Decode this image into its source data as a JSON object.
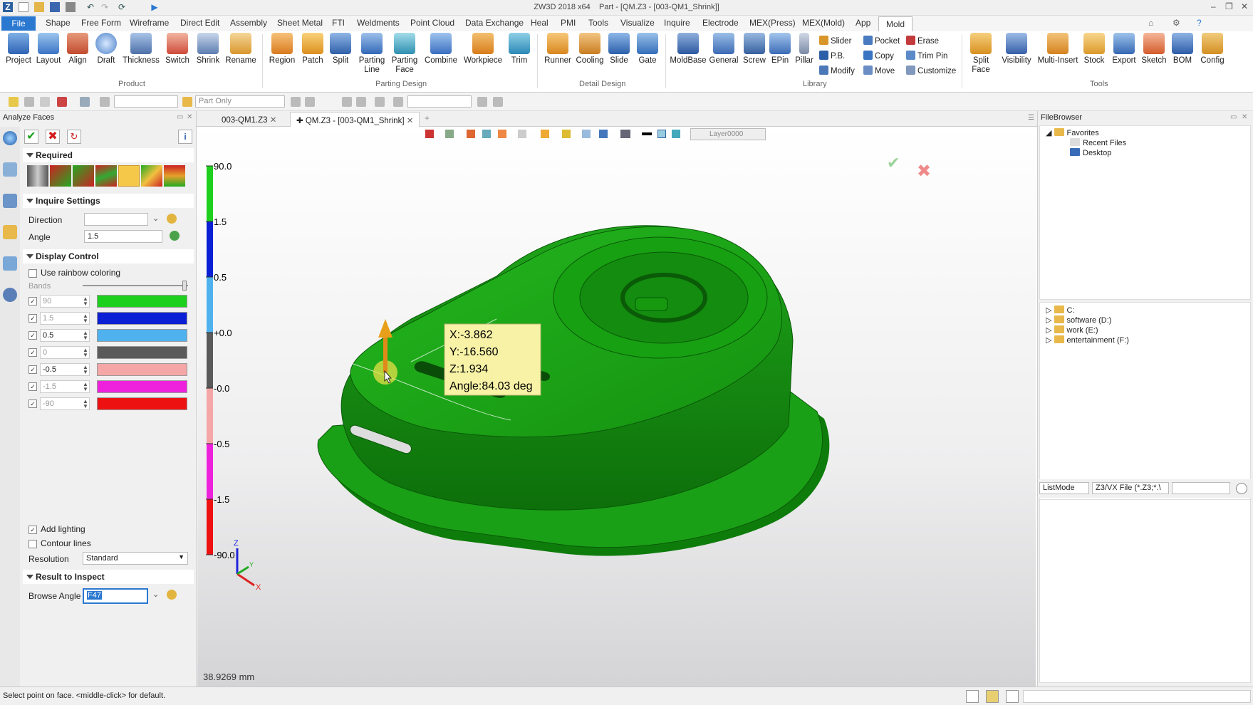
{
  "app": {
    "title": "ZW3D 2018 x64",
    "doc_title": "Part - [QM.Z3 - [003-QM1_Shrink]]"
  },
  "menu": [
    "Shape",
    "Free Form",
    "Wireframe",
    "Direct Edit",
    "Assembly",
    "Sheet Metal",
    "FTI",
    "Weldments",
    "Point Cloud",
    "Data Exchange",
    "Heal",
    "PMI",
    "Tools",
    "Visualize",
    "Inquire",
    "Electrode",
    "MEX(Press)",
    "MEX(Mold)",
    "App"
  ],
  "menu_file": "File",
  "menu_active": "Mold",
  "ribbon": {
    "product": [
      "Project",
      "Layout",
      "Align",
      "Draft",
      "Thickness",
      "Switch",
      "Shrink",
      "Rename"
    ],
    "parting": [
      "Region",
      "Patch",
      "Split",
      "Parting Line",
      "Parting Face",
      "Combine",
      "Workpiece",
      "Trim"
    ],
    "detail": [
      "Runner",
      "Cooling",
      "Slide",
      "Gate"
    ],
    "library": [
      "MoldBase",
      "General",
      "Screw",
      "EPin",
      "Pillar"
    ],
    "library_small": [
      "Slider",
      "Pocket",
      "Erase",
      "P.B.",
      "Copy",
      "Trim Pin",
      "Modify",
      "Move",
      "Customize"
    ],
    "tools": [
      "Split Face",
      "Visibility",
      "Multi-Insert",
      "Stock",
      "Export",
      "Sketch",
      "BOM",
      "Config"
    ],
    "groups": {
      "product": "Product",
      "parting": "Parting Design",
      "detail": "Detail Design",
      "library": "Library",
      "tools": "Tools"
    }
  },
  "toolbar2": {
    "filter": "Part Only"
  },
  "left": {
    "title": "Analyze Faces",
    "required": "Required",
    "inquire": "Inquire Settings",
    "direction_label": "Direction",
    "direction_value": "",
    "angle_label": "Angle",
    "angle_value": "1.5",
    "display": "Display Control",
    "rainbow": "Use rainbow coloring",
    "bands_label": "Bands",
    "bands": [
      {
        "value": "90",
        "color": "#1ed01e"
      },
      {
        "value": "1.5",
        "color": "#0b1fd4"
      },
      {
        "value": "0.5",
        "color": "#4fb2ee"
      },
      {
        "value": "0",
        "color": "#5a5a5a"
      },
      {
        "value": "-0.5",
        "color": "#f5a6a6"
      },
      {
        "value": "-1.5",
        "color": "#ee22dd"
      },
      {
        "value": "-90",
        "color": "#ee1111"
      }
    ],
    "lighting": "Add lighting",
    "contour": "Contour lines",
    "resolution_label": "Resolution",
    "resolution_value": "Standard",
    "result": "Result to Inspect",
    "browse_label": "Browse Angle",
    "browse_value": "F47"
  },
  "tabs": [
    "003-QM1.Z3",
    "QM.Z3 - [003-QM1_Shrink]"
  ],
  "viewport": {
    "layer": "Layer0000",
    "scale_labels": [
      "90.0",
      "1.5",
      "0.5",
      "+0.0",
      "-0.0",
      "-0.5",
      "-1.5",
      "-90.0"
    ],
    "tooltip": {
      "x": "X:-3.862",
      "y": "Y:-16.560",
      "z": "Z:1.934",
      "angle": "Angle:84.03 deg"
    },
    "dimension": "38.9269 mm",
    "axis": {
      "x": "X",
      "y": "Y",
      "z": "Z"
    }
  },
  "filebrowser": {
    "title": "FileBrowser",
    "favorites": "Favorites",
    "recent": "Recent Files",
    "desktop": "Desktop",
    "drives": [
      "C:",
      "software (D:)",
      "work (E:)",
      "entertainment (F:)"
    ],
    "mode": "ListMode",
    "filter": "Z3/VX File (*.Z3;*.\\"
  },
  "status": {
    "prompt": "Select point on face. <middle-click> for default."
  }
}
